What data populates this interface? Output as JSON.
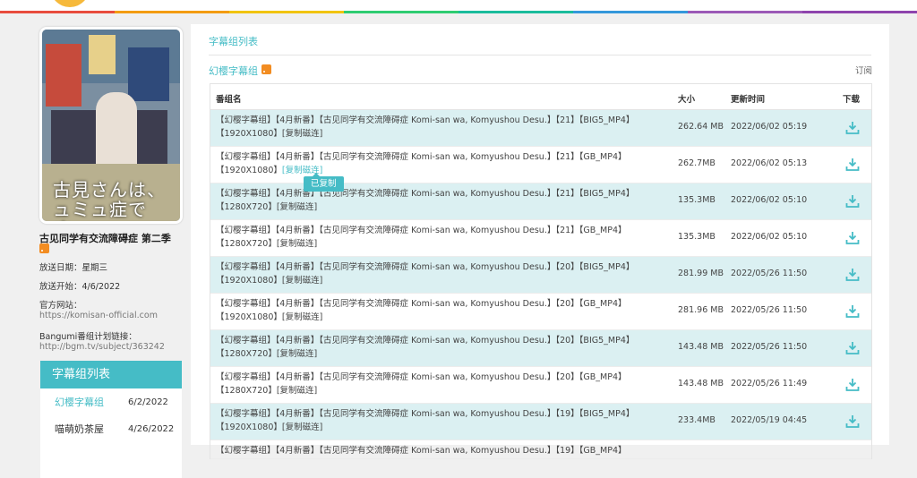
{
  "colors": {
    "accent": "#45bcc6",
    "row_alt": "#dbf0f2",
    "rss": "#f28c21"
  },
  "rainbow_colors": [
    "#e84c3d",
    "#f39c12",
    "#f1c40f",
    "#2ecc71",
    "#1abc9c",
    "#3498db",
    "#9b59b6",
    "#8e44ad"
  ],
  "sidebar": {
    "poster_text_line1": "古見さんは、",
    "poster_text_line2": "ュミュ症です。",
    "title": "古见同学有交流障碍症 第二季",
    "air_date": "放送日期：星期三",
    "start_date": "放送开始：4/6/2022",
    "official_site_label": "官方网站：",
    "official_site_url": "https://komisan-official.com",
    "bangumi_label": "Bangumi番组计划链接：",
    "bangumi_url": "http://bgm.tv/subject/363242",
    "list_title": "字幕组列表",
    "groups": [
      {
        "name": "幻樱字幕组",
        "date": "6/2/2022"
      },
      {
        "name": "喵萌奶茶屋",
        "date": "4/26/2022"
      }
    ]
  },
  "main": {
    "title": "字幕组列表",
    "group_name": "幻樱字幕组",
    "subscribe": "订阅",
    "columns": {
      "name": "番组名",
      "size": "大小",
      "time": "更新时间",
      "download": "下载"
    },
    "copied_tooltip": "已复制",
    "rows": [
      {
        "line1": "【幻樱字幕组】【4月新番】【古见同学有交流障碍症 Komi-san wa, Komyushou Desu.】【21】【BIG5_MP4】",
        "line2": "【1920X1080】",
        "magnet": "[复制磁连]",
        "size": "262.64 MB",
        "time": "2022/06/02 05:19"
      },
      {
        "line1": "【幻樱字幕组】【4月新番】【古见同学有交流障碍症 Komi-san wa, Komyushou Desu.】【21】【GB_MP4】",
        "line2": "【1920X1080】",
        "magnet": "[复制磁连]",
        "size": "262.7MB",
        "time": "2022/06/02 05:13"
      },
      {
        "line1": "【幻樱字幕组】【4月新番】【古见同学有交流障碍症 Komi-san wa, Komyushou Desu.】【21】【BIG5_MP4】",
        "line2": "【1280X720】",
        "magnet": "[复制磁连]",
        "size": "135.3MB",
        "time": "2022/06/02 05:10"
      },
      {
        "line1": "【幻樱字幕组】【4月新番】【古见同学有交流障碍症 Komi-san wa, Komyushou Desu.】【21】【GB_MP4】",
        "line2": "【1280X720】",
        "magnet": "[复制磁连]",
        "size": "135.3MB",
        "time": "2022/06/02 05:10"
      },
      {
        "line1": "【幻樱字幕组】【4月新番】【古见同学有交流障碍症 Komi-san wa, Komyushou Desu.】【20】【BIG5_MP4】",
        "line2": "【1920X1080】",
        "magnet": "[复制磁连]",
        "size": "281.99 MB",
        "time": "2022/05/26 11:50"
      },
      {
        "line1": "【幻樱字幕组】【4月新番】【古见同学有交流障碍症 Komi-san wa, Komyushou Desu.】【20】【GB_MP4】",
        "line2": "【1920X1080】",
        "magnet": "[复制磁连]",
        "size": "281.96 MB",
        "time": "2022/05/26 11:50"
      },
      {
        "line1": "【幻樱字幕组】【4月新番】【古见同学有交流障碍症 Komi-san wa, Komyushou Desu.】【20】【BIG5_MP4】",
        "line2": "【1280X720】",
        "magnet": "[复制磁连]",
        "size": "143.48 MB",
        "time": "2022/05/26 11:50"
      },
      {
        "line1": "【幻樱字幕组】【4月新番】【古见同学有交流障碍症 Komi-san wa, Komyushou Desu.】【20】【GB_MP4】",
        "line2": "【1280X720】",
        "magnet": "[复制磁连]",
        "size": "143.48 MB",
        "time": "2022/05/26 11:49"
      },
      {
        "line1": "【幻樱字幕组】【4月新番】【古见同学有交流障碍症 Komi-san wa, Komyushou Desu.】【19】【BIG5_MP4】",
        "line2": "【1920X1080】",
        "magnet": "[复制磁连]",
        "size": "233.4MB",
        "time": "2022/05/19 04:45"
      },
      {
        "line1": "【幻樱字幕组】【4月新番】【古见同学有交流障碍症 Komi-san wa, Komyushou Desu.】【19】【GB_MP4】",
        "line2": "",
        "magnet": "",
        "size": "",
        "time": ""
      }
    ]
  }
}
